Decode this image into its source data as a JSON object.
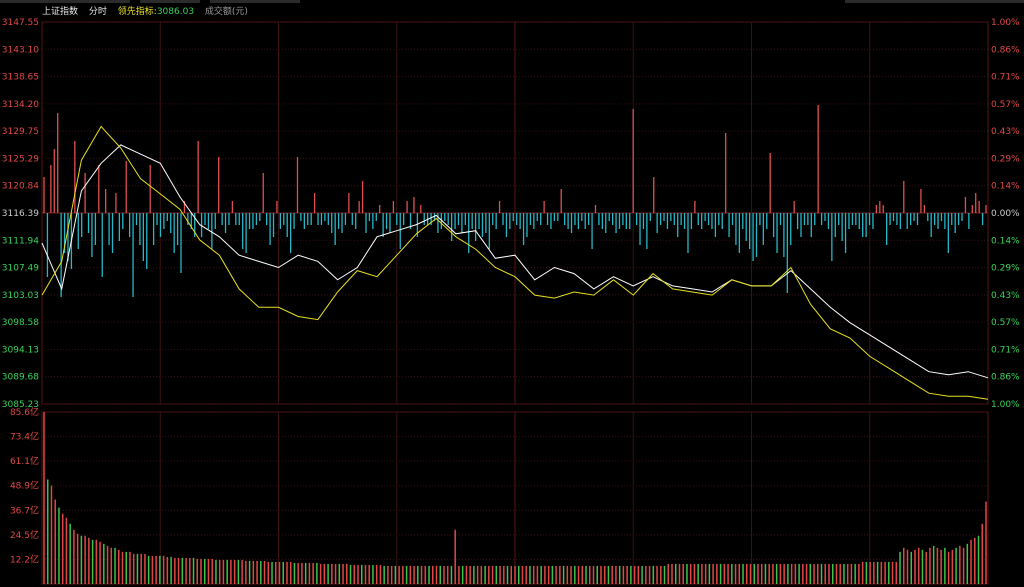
{
  "header": {
    "index_name": "上证指数",
    "mode": "分时",
    "leading_label": "领先指标:",
    "leading_value": "3086.03",
    "volume_label": "成交额(元)"
  },
  "colors": {
    "up": "#e05050",
    "down": "#26b8c9",
    "grid": "#3a1010",
    "price_line": "#ffffff",
    "leading_line": "#e8e020",
    "axis_text": "#e04848",
    "axis_text_down": "#37d25a",
    "volume_up": "#e04848",
    "volume_down": "#3ec24a"
  },
  "price_axis": {
    "left_labels": [
      "3147.55",
      "3143.10",
      "3138.65",
      "3134.20",
      "3129.75",
      "3125.29",
      "3120.84",
      "3116.39",
      "3111.94",
      "3107.49",
      "3103.03",
      "3098.58",
      "3094.13",
      "3089.68",
      "3085.23"
    ],
    "right_labels": [
      "1.00%",
      "0.86%",
      "0.71%",
      "0.57%",
      "0.43%",
      "0.29%",
      "0.14%",
      "0.00%",
      "0.14%",
      "0.29%",
      "0.43%",
      "0.57%",
      "0.71%",
      "0.86%",
      "1.00%"
    ]
  },
  "volume_axis": {
    "labels": [
      "85.6亿",
      "73.4亿",
      "61.1亿",
      "48.9亿",
      "36.7亿",
      "24.5亿",
      "12.2亿"
    ]
  },
  "chart_data": {
    "type": "line",
    "prev_close": 3116.39,
    "ylim": [
      3085.23,
      3147.55
    ],
    "x": [
      0,
      5,
      10,
      15,
      20,
      25,
      30,
      35,
      40,
      45,
      50,
      55,
      60,
      65,
      70,
      75,
      80,
      85,
      90,
      95,
      100,
      105,
      110,
      115,
      120,
      125,
      130,
      135,
      140,
      145,
      150,
      155,
      160,
      165,
      170,
      175,
      180,
      185,
      190,
      195,
      200,
      205,
      210,
      215,
      220,
      225,
      230,
      235,
      240
    ],
    "series": [
      {
        "values": [
          3111.5,
          3104.0,
          3120.0,
          3124.5,
          3127.5,
          3126.0,
          3124.5,
          3119.0,
          3114.5,
          3112.5,
          3109.5,
          3108.5,
          3107.5,
          3109.5,
          3108.5,
          3105.5,
          3107.5,
          3112.5,
          3113.5,
          3114.5,
          3116.0,
          3113.0,
          3113.5,
          3109.0,
          3109.5,
          3105.5,
          3107.5,
          3106.5,
          3104.0,
          3106.0,
          3104.5,
          3106.0,
          3104.5,
          3104.0,
          3103.5,
          3105.5,
          3104.5,
          3104.5,
          3107.0,
          3104.0,
          3101.0,
          3098.5,
          3096.5,
          3094.5,
          3092.5,
          3090.5,
          3090.0,
          3090.5,
          3089.5
        ]
      },
      {
        "values": [
          3103.0,
          3108.5,
          3125.0,
          3130.5,
          3127.0,
          3122.0,
          3119.5,
          3117.0,
          3112.0,
          3109.5,
          3104.0,
          3101.0,
          3101.0,
          3099.5,
          3099.0,
          3103.5,
          3107.0,
          3106.0,
          3109.5,
          3113.0,
          3115.5,
          3112.5,
          3110.5,
          3107.5,
          3106.0,
          3103.0,
          3102.5,
          3103.5,
          3103.0,
          3105.5,
          3103.0,
          3106.5,
          3104.0,
          3103.5,
          3103.0,
          3105.5,
          3104.5,
          3104.5,
          3107.5,
          3101.5,
          3097.5,
          3096.0,
          3093.0,
          3091.0,
          3089.0,
          3087.0,
          3086.5,
          3086.5,
          3086.0
        ]
      }
    ],
    "volume": [
      85.6,
      52.0,
      49.0,
      42.0,
      38.0,
      35.0,
      33.0,
      30.0,
      27.0,
      25.0,
      24.0,
      24.0,
      23.0,
      22.0,
      22.0,
      21.0,
      20.0,
      19.0,
      18.0,
      18.0,
      17.0,
      16.0,
      16.0,
      16.0,
      15.0,
      15.0,
      15.0,
      15.0,
      14.0,
      14.0,
      14.0,
      14.0,
      14.0,
      13.5,
      13.5,
      13.0,
      13.0,
      13.0,
      13.0,
      13.0,
      13.0,
      12.5,
      12.5,
      12.5,
      12.5,
      12.5,
      12.0,
      12.0,
      12.0,
      12.0,
      12.0,
      12.0,
      12.0,
      12.0,
      11.5,
      11.5,
      11.5,
      11.5,
      11.5,
      11.5,
      11.0,
      11.0,
      11.0,
      11.0,
      11.0,
      11.0,
      11.0,
      10.5,
      10.5,
      10.5,
      10.5,
      10.5,
      10.5,
      10.5,
      10.0,
      10.0,
      10.0,
      10.0,
      10.0,
      10.0,
      10.0,
      10.0,
      9.5,
      9.5,
      9.5,
      9.5,
      9.5,
      9.5,
      9.5,
      9.5,
      9.5,
      9.0,
      9.0,
      9.0,
      9.0,
      9.0,
      9.0,
      9.0,
      9.0,
      9.0,
      9.0,
      9.0,
      9.0,
      9.0,
      9.0,
      9.0,
      9.0,
      9.0,
      9.0,
      9.0,
      27.0,
      9.0,
      9.0,
      9.0,
      9.0,
      9.0,
      9.0,
      9.0,
      9.0,
      9.0,
      9.0,
      9.0,
      9.0,
      9.0,
      9.0,
      9.0,
      9.0,
      9.0,
      9.0,
      9.0,
      9.0,
      9.0,
      9.0,
      9.0,
      9.0,
      9.0,
      9.0,
      9.0,
      9.0,
      9.0,
      9.0,
      9.0,
      9.0,
      9.0,
      9.0,
      9.0,
      9.0,
      9.0,
      9.0,
      9.0,
      9.0,
      9.0,
      9.0,
      9.0,
      9.0,
      9.0,
      9.0,
      9.0,
      9.0,
      9.0,
      9.0,
      9.0,
      9.0,
      9.0,
      9.0,
      9.0,
      9.0,
      10.0,
      10.0,
      10.0,
      10.0,
      10.0,
      10.0,
      10.0,
      10.0,
      10.0,
      10.0,
      10.0,
      10.0,
      10.0,
      10.0,
      10.0,
      10.0,
      10.0,
      10.0,
      10.0,
      10.0,
      10.0,
      10.0,
      10.0,
      10.0,
      10.0,
      10.0,
      10.0,
      10.0,
      10.0,
      10.0,
      10.0,
      10.0,
      10.0,
      10.0,
      10.0,
      10.0,
      10.0,
      10.0,
      10.0,
      10.0,
      10.0,
      10.0,
      10.0,
      10.0,
      10.0,
      10.0,
      10.0,
      10.0,
      10.0,
      10.0,
      10.0,
      10.0,
      11.0,
      11.0,
      11.0,
      11.0,
      11.0,
      11.0,
      11.0,
      11.0,
      11.0,
      11.0,
      16.0,
      18.0,
      17.0,
      16.0,
      17.0,
      18.0,
      17.0,
      16.0,
      18.0,
      19.0,
      18.0,
      17.0,
      18.0,
      16.0,
      17.0,
      18.0,
      19.0,
      18.0,
      20.0,
      22.0,
      23.0,
      24.0,
      30.0,
      41.0
    ],
    "diff_bars": [
      9,
      -16,
      12,
      16,
      25,
      -21,
      -10,
      -12,
      -14,
      18,
      -9,
      -6,
      10,
      -5,
      -11,
      -8,
      12,
      -16,
      6,
      -8,
      -10,
      5,
      -7,
      -4,
      13,
      -6,
      -21,
      -3,
      -8,
      -12,
      -14,
      12,
      -8,
      -3,
      -6,
      -4,
      -2,
      -5,
      -10,
      -8,
      -15,
      3,
      -3,
      -4,
      -6,
      18,
      -6,
      -3,
      -4,
      -9,
      -4,
      14,
      -3,
      -5,
      -3,
      3,
      -3,
      -3,
      -9,
      -10,
      -4,
      -4,
      -3,
      -2,
      10,
      -3,
      -8,
      -6,
      3,
      -4,
      -3,
      -6,
      -10,
      -4,
      14,
      -2,
      -4,
      -3,
      -3,
      5,
      -3,
      -3,
      -2,
      -3,
      -5,
      -8,
      -4,
      -5,
      -3,
      5,
      -3,
      -4,
      3,
      8,
      -5,
      -2,
      -4,
      -2,
      2,
      -6,
      -4,
      -5,
      3,
      -3,
      -9,
      -3,
      3,
      -4,
      4,
      -6,
      2,
      -3,
      -3,
      -3,
      -2,
      -5,
      -4,
      -2,
      -3,
      -7,
      -4,
      -3,
      -5,
      -3,
      -10,
      -4,
      -7,
      -4,
      -6,
      -5,
      -9,
      -3,
      -4,
      3,
      -3,
      -6,
      -4,
      -2,
      -3,
      -4,
      -8,
      -6,
      -3,
      -4,
      -2,
      -3,
      3,
      -3,
      -4,
      -2,
      -2,
      6,
      -3,
      -4,
      -5,
      -3,
      -4,
      -2,
      -4,
      -3,
      -9,
      2,
      -3,
      -4,
      -5,
      -2,
      -3,
      -5,
      -4,
      -3,
      -4,
      -4,
      26,
      -3,
      -8,
      -4,
      -9,
      -2,
      9,
      -5,
      -3,
      -2,
      -4,
      -2,
      -3,
      -6,
      -3,
      -4,
      -10,
      -4,
      3,
      -3,
      -4,
      -2,
      -3,
      -4,
      -6,
      -3,
      -4,
      20,
      -6,
      -3,
      -8,
      -10,
      -4,
      -7,
      -9,
      -12,
      -11,
      -3,
      -8,
      -4,
      15,
      -6,
      -10,
      -3,
      -11,
      -20,
      -8,
      3,
      -4,
      -6,
      -3,
      -3,
      -6,
      -3,
      27,
      -3,
      -2,
      -4,
      -12,
      -6,
      -3,
      -7,
      -10,
      -4,
      -3,
      -3,
      -4,
      -6,
      -6,
      -3,
      -4,
      2,
      3,
      2,
      -8,
      -3,
      -2,
      -3,
      -4,
      8,
      -4,
      -3,
      -2,
      -3,
      6,
      2,
      -2,
      -6,
      -3,
      -4,
      -2,
      -4,
      -10,
      -3,
      -5,
      -3,
      -2,
      4,
      -4,
      2,
      5,
      3,
      -3,
      2
    ]
  }
}
